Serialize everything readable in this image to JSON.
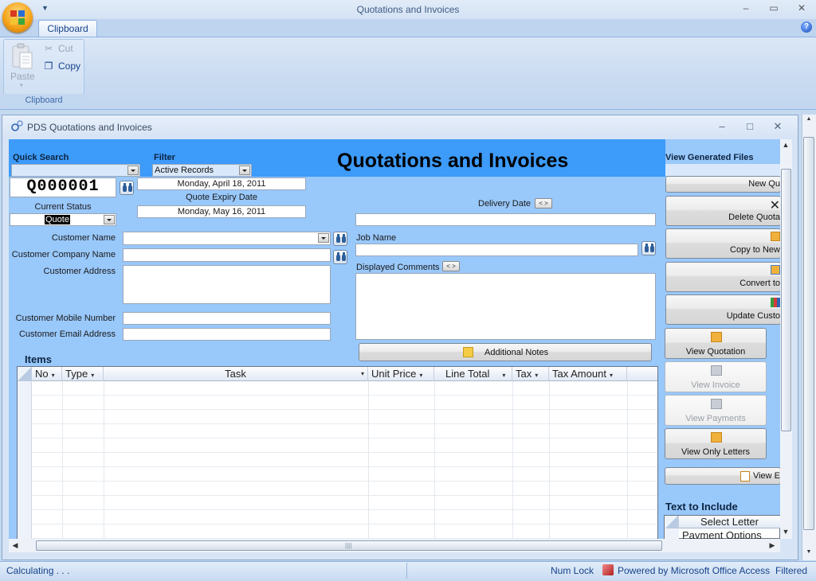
{
  "app": {
    "title": "Quotations and Invoices",
    "window_controls": {
      "minimize": "–",
      "restore": "▭",
      "close": "✕"
    },
    "qat_icon": "customize-quick-access-icon",
    "help_glyph": "?"
  },
  "ribbon": {
    "tabs": [
      {
        "label": "Clipboard",
        "active": true
      }
    ],
    "groups": [
      {
        "label": "Clipboard",
        "buttons": [
          {
            "label": "Paste",
            "icon": "paste-icon",
            "enabled": false,
            "dropdown": "▾"
          },
          {
            "label": "Cut",
            "icon": "scissors-icon",
            "enabled": false
          },
          {
            "label": "Copy",
            "icon": "copy-icon",
            "enabled": true
          }
        ]
      }
    ]
  },
  "document": {
    "title": "PDS Quotations and Invoices",
    "controls": {
      "minimize": "–",
      "maximize": "□",
      "close": "✕"
    }
  },
  "form": {
    "title": "Quotations and Invoices",
    "quick_search": {
      "label": "Quick Search",
      "value": ""
    },
    "filter": {
      "label": "Filter",
      "value": "Active Records"
    },
    "quote_id": "Q000001",
    "quote_date": "Monday, April 18, 2011",
    "quote_expiry": {
      "label": "Quote Expiry Date",
      "value": "Monday, May 16, 2011"
    },
    "current_status": {
      "label": "Current Status",
      "value": "Quote"
    },
    "delivery_date": {
      "label": "Delivery Date",
      "value": "",
      "toggle": "< >"
    },
    "customer_name": {
      "label": "Customer Name",
      "value": ""
    },
    "customer_company": {
      "label": "Customer Company Name",
      "value": ""
    },
    "customer_address": {
      "label": "Customer Address",
      "value": ""
    },
    "customer_mobile": {
      "label": "Customer Mobile Number",
      "value": ""
    },
    "customer_email": {
      "label": "Customer Email Address",
      "value": ""
    },
    "job_name": {
      "label": "Job Name",
      "value": ""
    },
    "displayed_comments": {
      "label": "Displayed Comments",
      "value": "",
      "toggle": "< >"
    },
    "additional_notes_button": "Additional Notes"
  },
  "items": {
    "label": "Items",
    "columns": [
      {
        "label": "No",
        "sortable": true
      },
      {
        "label": "Type",
        "sortable": true
      },
      {
        "label": "Task",
        "sortable": true
      },
      {
        "label": "Unit Price",
        "sortable": true
      },
      {
        "label": "Line Total",
        "sortable": true
      },
      {
        "label": "Tax",
        "sortable": true
      },
      {
        "label": "Tax Amount",
        "sortable": true
      }
    ],
    "rows": [],
    "dropdown_glyph": "▾"
  },
  "sidebar": {
    "view_generated_files": {
      "label": "View Generated Files",
      "value": ""
    },
    "actions": [
      {
        "label": "New Qu",
        "enabled": true
      },
      {
        "label": "Delete Quota",
        "enabled": true,
        "icon": "delete-x-icon"
      },
      {
        "label": "Copy to New",
        "enabled": true,
        "icon": "copy-record-icon"
      },
      {
        "label": "Convert to",
        "enabled": true,
        "icon": "convert-icon"
      },
      {
        "label": "Update Custo",
        "enabled": true,
        "icon": "update-customer-icon"
      }
    ],
    "reports": [
      {
        "label": "View Quotation",
        "enabled": true
      },
      {
        "label": "View Invoice",
        "enabled": false
      },
      {
        "label": "View Payments",
        "enabled": false
      },
      {
        "label": "View Only Letters",
        "enabled": true
      }
    ],
    "view_e_button": "View E",
    "text_to_include": {
      "label": "Text to Include",
      "column": "Select Letter",
      "rows": [
        "Payment Options"
      ]
    }
  },
  "status_bar": {
    "message": "Calculating . . .",
    "num_lock": "Num Lock",
    "powered_by": "Powered by Microsoft Office Access",
    "filtered": "Filtered"
  }
}
